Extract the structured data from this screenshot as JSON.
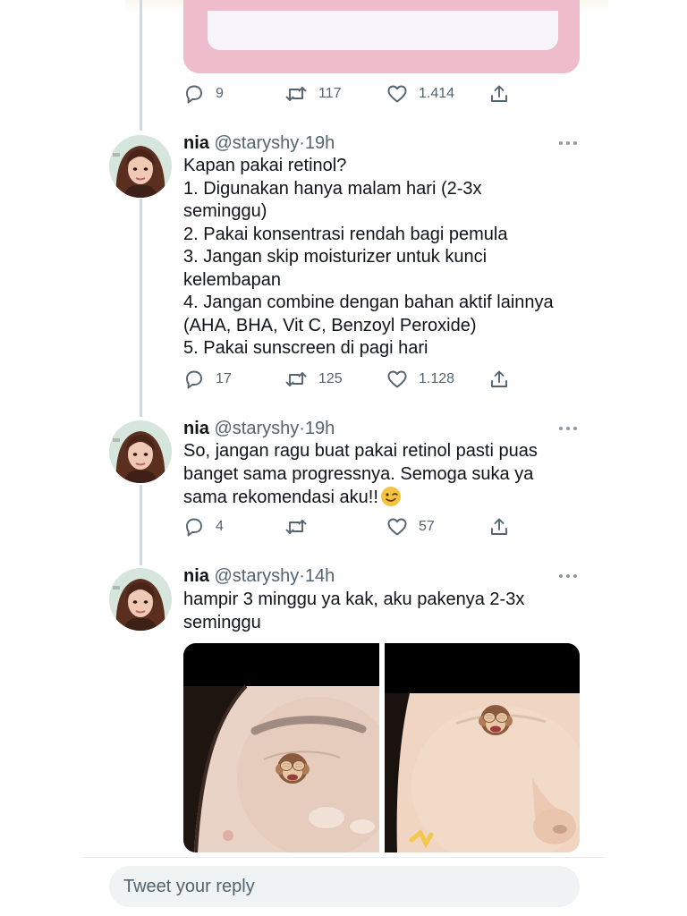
{
  "colors": {
    "text_primary": "#0f1419",
    "text_secondary": "#536471",
    "thread_line": "#cfd9de",
    "card_pink": "#efbccb",
    "reply_bg": "#eff3f4"
  },
  "top_tweet": {
    "actions": {
      "replies": "9",
      "retweets": "117",
      "likes": "1.414"
    }
  },
  "tweets": [
    {
      "name": "nia",
      "handle": "@staryshy",
      "sep": "·",
      "time": "19h",
      "lines": [
        "Kapan pakai retinol?",
        "1. Digunakan hanya malam hari (2-3x",
        "seminggu)",
        "2. Pakai konsentrasi rendah bagi pemula",
        "3. Jangan skip moisturizer untuk kunci",
        "kelembapan",
        "4. Jangan combine dengan bahan aktif lainnya",
        "(AHA, BHA, Vit C, Benzoyl Peroxide)",
        "5. Pakai sunscreen di pagi hari"
      ],
      "actions": {
        "replies": "17",
        "retweets": "125",
        "likes": "1.128"
      }
    },
    {
      "name": "nia",
      "handle": "@staryshy",
      "sep": "·",
      "time": "19h",
      "lines": [
        "So, jangan ragu buat pakai retinol pasti puas",
        "banget sama progressnya. Semoga suka ya",
        "sama rekomendasi aku!!"
      ],
      "emoji": "winking-face",
      "actions": {
        "replies": "4",
        "retweets": "",
        "likes": "57"
      }
    },
    {
      "name": "nia",
      "handle": "@staryshy",
      "sep": "·",
      "time": "14h",
      "lines": [
        "hampir 3 minggu ya kak, aku pakenya 2-3x",
        "seminggu"
      ],
      "media": [
        "before-face-photo",
        "after-face-photo"
      ],
      "media_sticker": "see-no-evil-monkey-emoji"
    }
  ],
  "icons": {
    "reply": "reply-icon",
    "retweet": "retweet-icon",
    "like": "heart-icon",
    "share": "share-icon",
    "more": "more-icon"
  },
  "reply_box": {
    "placeholder": "Tweet your reply"
  }
}
